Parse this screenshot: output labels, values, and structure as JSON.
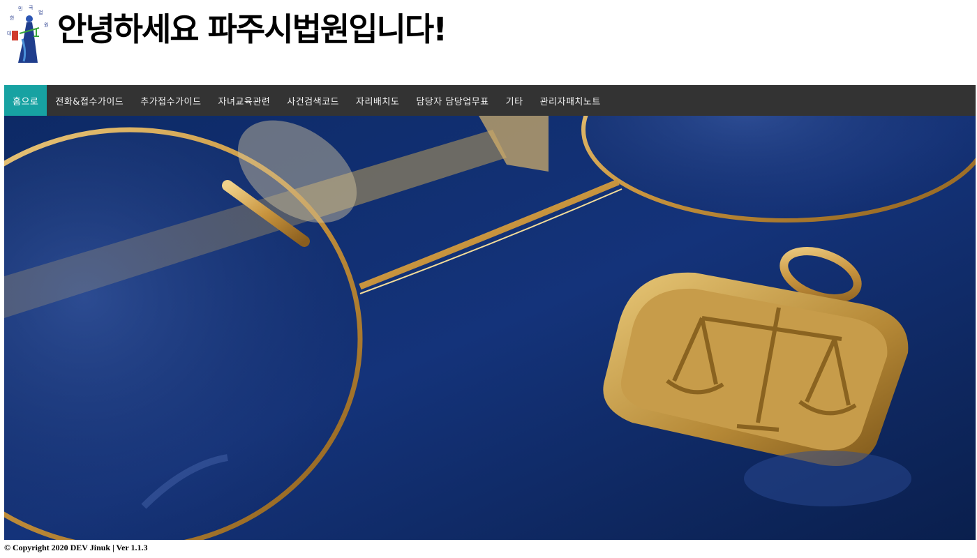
{
  "header": {
    "logo_icon": "court-emblem-logo",
    "logo_text": "대한민국법원",
    "title": "안녕하세요 파주시법원입니다!"
  },
  "nav": {
    "items": [
      {
        "label": "홈으로",
        "active": true
      },
      {
        "label": "전화&접수가이드"
      },
      {
        "label": "추가접수가이드"
      },
      {
        "label": "자녀교육관련"
      },
      {
        "label": "사건검색코드"
      },
      {
        "label": "자리배치도"
      },
      {
        "label": "담당자 담당업무표"
      },
      {
        "label": "기타"
      },
      {
        "label": "관리자패치노트"
      }
    ],
    "bg_color": "#333333",
    "active_color": "#17a2a2"
  },
  "hero": {
    "image": "gold-glasses-and-scales-pendant-photo"
  },
  "footer": {
    "text": "© Copyright 2020 DEV Jinuk  |  Ver 1.1.3"
  }
}
